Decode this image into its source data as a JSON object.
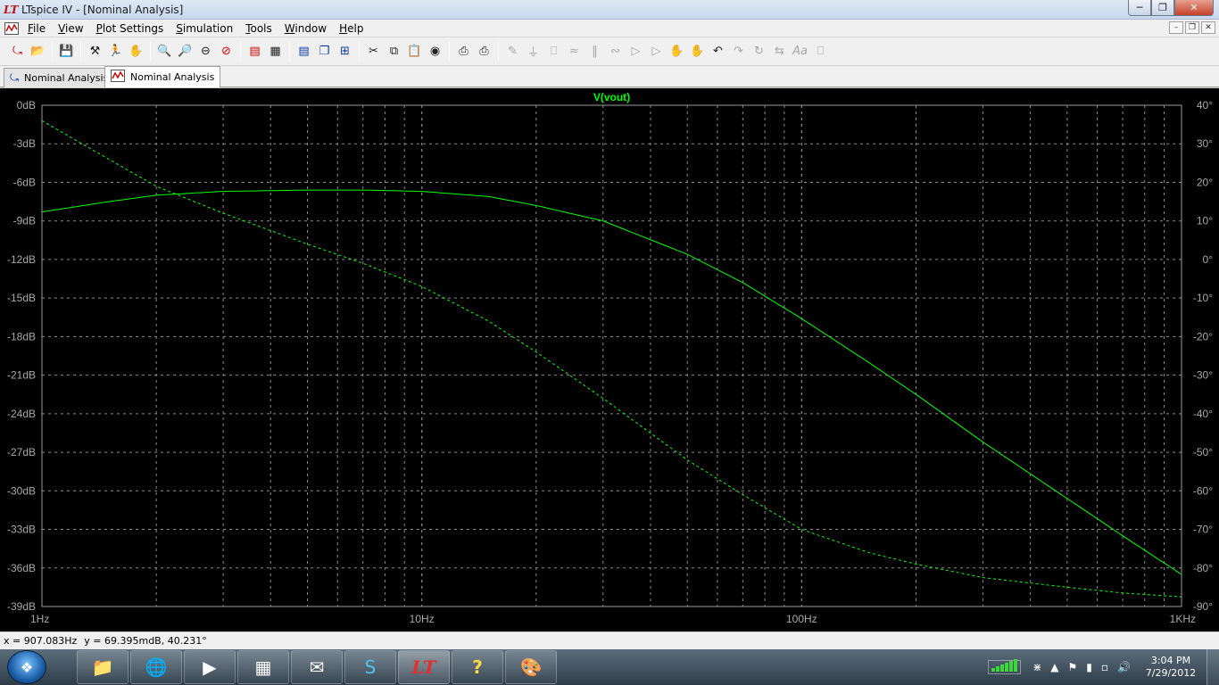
{
  "window": {
    "app_icon": "ltspice-logo-icon",
    "title": "LTspice IV - [Nominal Analysis]",
    "controls": [
      "minimize-icon",
      "restore-icon",
      "close-icon"
    ]
  },
  "menu": {
    "items": [
      "File",
      "View",
      "Plot Settings",
      "Simulation",
      "Tools",
      "Window",
      "Help"
    ]
  },
  "toolbar": {
    "buttons": [
      "new-schematic-icon",
      "open-icon",
      "save-icon",
      "control-panel-icon",
      "run-icon",
      "pan-icon",
      "zoom-in-icon",
      "zoom-in-alt-icon",
      "zoom-out-icon",
      "zoom-cancel-icon",
      "autorange-icon",
      "zoom-fit-icon",
      "tile-horizontal-icon",
      "cascade-icon",
      "close-all-icon",
      "cut-icon",
      "copy-icon",
      "paste-icon",
      "find-icon",
      "print-preview-icon",
      "print-icon",
      "wire-icon",
      "ground-icon",
      "label-net-icon",
      "resistor-icon",
      "capacitor-icon",
      "inductor-icon",
      "diode-icon",
      "component-icon",
      "move-icon",
      "drag-icon",
      "undo-icon",
      "redo-icon",
      "rotate-icon",
      "mirror-icon",
      "text-icon",
      "spice-directive-icon"
    ]
  },
  "tabs": [
    {
      "label": "Nominal Analysis",
      "icon": "schematic-icon",
      "active": false
    },
    {
      "label": "Nominal Analysis",
      "icon": "waveform-icon",
      "active": true
    }
  ],
  "status": {
    "x_readout": "x = 907.083Hz",
    "y_readout": "y = 69.395mdB, 40.231°"
  },
  "taskbar": {
    "apps": [
      "windows-explorer-icon",
      "firefox-icon",
      "media-player-icon",
      "calculator-icon",
      "mail-icon",
      "skype-icon",
      "ltspice-icon",
      "help-icon",
      "paint-icon"
    ],
    "active_app": "ltspice-icon",
    "time": "3:04 PM",
    "date": "7/29/2012"
  },
  "chart_data": {
    "type": "line",
    "title": "V(vout)",
    "xscale": "log",
    "xlim": [
      1,
      1000
    ],
    "x_ticks": [
      "1Hz",
      "10Hz",
      "100Hz",
      "1KHz"
    ],
    "ylim_left": [
      -39,
      0
    ],
    "y_ticks_left": [
      "0dB",
      "-3dB",
      "-6dB",
      "-9dB",
      "-12dB",
      "-15dB",
      "-18dB",
      "-21dB",
      "-24dB",
      "-27dB",
      "-30dB",
      "-33dB",
      "-36dB",
      "-39dB"
    ],
    "ylim_right": [
      -90,
      40
    ],
    "y_ticks_right": [
      "40°",
      "30°",
      "20°",
      "10°",
      "0°",
      "-10°",
      "-20°",
      "-30°",
      "-40°",
      "-50°",
      "-60°",
      "-70°",
      "-80°",
      "-90°"
    ],
    "grid": true,
    "series": [
      {
        "name": "V(vout)",
        "axis": "left",
        "style": "solid",
        "color": "#00ff00",
        "x": [
          1,
          1.5,
          2,
          3,
          5,
          7,
          10,
          15,
          20,
          30,
          50,
          70,
          100,
          150,
          200,
          300,
          500,
          700,
          1000
        ],
        "y": [
          -8.3,
          -7.5,
          -7.0,
          -6.7,
          -6.6,
          -6.6,
          -6.7,
          -7.1,
          -7.8,
          -9.0,
          -11.6,
          -13.8,
          -16.6,
          -20.0,
          -22.5,
          -26.2,
          -30.6,
          -33.5,
          -36.5
        ]
      },
      {
        "name": "V(vout) phase",
        "axis": "right",
        "style": "dashed",
        "color": "#00ff00",
        "x": [
          1,
          1.5,
          2,
          3,
          5,
          7,
          10,
          15,
          20,
          30,
          50,
          70,
          100,
          150,
          200,
          300,
          500,
          700,
          1000
        ],
        "y": [
          36,
          26,
          19,
          12,
          4,
          -1,
          -7,
          -16,
          -24,
          -36,
          -52,
          -61,
          -70,
          -76,
          -79,
          -82.5,
          -85,
          -86.5,
          -87.5
        ]
      }
    ]
  }
}
